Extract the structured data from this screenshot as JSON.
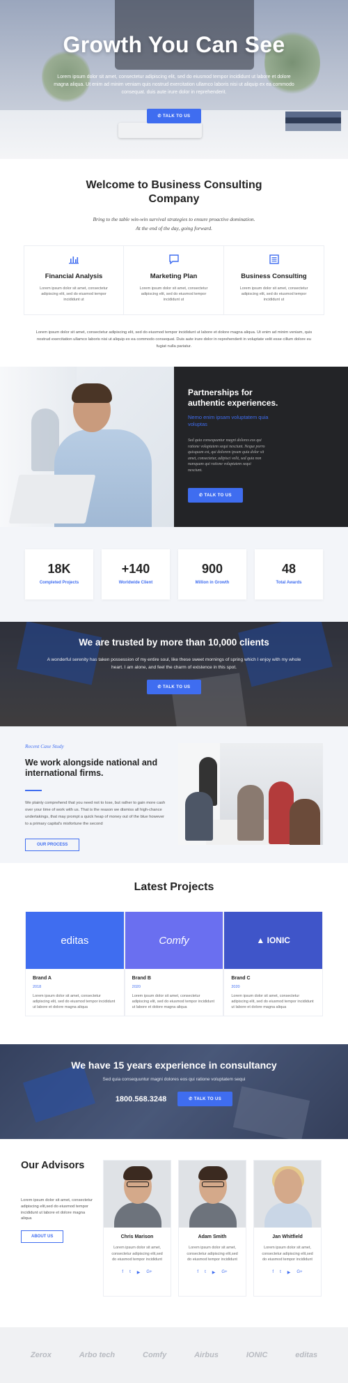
{
  "hero": {
    "title": "Growth You Can See",
    "text": "Lorem ipsum dolor sit amet, consectetur adipiscing elit, sed do eiusmod tempor incididunt ut labore et dolore magna aliqua. Ut enim ad minim veniam quis nostrud exercitation ullamco laboris nisi ut aliquip ex ea commodo consequat. duis aute irure dolor in reprehenderit.",
    "button": "TALK TO US"
  },
  "welcome": {
    "title": "Welcome to Business Consulting Company",
    "subtitle_line1": "Bring to the table win-win survival strategies to ensure proactive domination.",
    "subtitle_line2": "At the end of the day, going forward.",
    "services": [
      {
        "icon": "chart-icon",
        "title": "Financial Analysis",
        "text": "Lorem ipsum dolor sit amet, consectetur adipiscing elit, sed do eiusmod tempor incididunt ut"
      },
      {
        "icon": "chat-icon",
        "title": "Marketing Plan",
        "text": "Lorem ipsum dolor sit amet, consectetur adipiscing elit, sed do eiusmod tempor incididunt ut"
      },
      {
        "icon": "document-icon",
        "title": "Business Consulting",
        "text": "Lorem ipsum dolor sit amet, consectetur adipiscing elit, sed do eiusmod tempor incididunt ut"
      }
    ],
    "paragraph": "Lorem ipsum dolor sit amet, consectetur adipiscing elit, sed do eiusmod tempor incididunt ut labore et dolore magna aliqua. Ut enim ad minim veniam, quis nostrud exercitation ullamco laboris nisi ut aliquip ex ea commodo consequat. Duis aute irure dolor in reprehenderit in voluptate velit esse cillum dolore eu fugiat nulla pariatur."
  },
  "partnership": {
    "title": "Partnerships for authentic experiences.",
    "highlight": "Nemo enim ipsam voluptatem quia voluptas",
    "body": "Sed quia consequuntur magni dolores eos qui ratione voluptatem sequi nesciunt. Neque porro quisquam est, qui dolorem ipsum quia dolor sit amet, consectetur, adipisci velit, sed quia non numquam qui ratione voluptatem sequi nesciunt.",
    "button": "TALK TO US"
  },
  "stats": [
    {
      "value": "18K",
      "label": "Completed Projects"
    },
    {
      "value": "+140",
      "label": "Worldwide Client"
    },
    {
      "value": "900",
      "label": "Million in Growth"
    },
    {
      "value": "48",
      "label": "Total Awards"
    }
  ],
  "trusted": {
    "title": "We are trusted by more than 10,000 clients",
    "text": "A wonderful serenity has taken possession of my entire soul, like these sweet mornings of spring which I enjoy with my whole heart. I am alone, and feel the charm of existence in this spot.",
    "button": "TALK TO US"
  },
  "case_study": {
    "tag": "Recent Case Study",
    "title": "We work alongside national and international firms.",
    "text": "We plainly comprehend that you need not to lose, but rather to gain more cash over your time of work with us. That is the reason we dismiss all high-chance undertakings, that may prompt a quick heap of money out of the blue however to a primary capital's misfortune the second",
    "button": "OUR PROCESS"
  },
  "projects": {
    "title": "Latest Projects",
    "items": [
      {
        "logo": "editas",
        "bg": "#3f6df0",
        "name": "Brand A",
        "year": "2018",
        "text": "Lorem ipsum dolor sit amet, consectetur adipiscing elit, sed do eiusmod tempor incididunt ut labore et dolore magna aliqua"
      },
      {
        "logo": "Comfy",
        "bg": "#6a6ff0",
        "name": "Brand B",
        "year": "2020",
        "text": "Lorem ipsum dolor sit amet, consectetur adipiscing elit, sed do eiusmod tempor incididunt ut labore et dolore magna aliqua"
      },
      {
        "logo": "IONIC",
        "bg": "#3f55c9",
        "name": "Brand C",
        "year": "2020",
        "text": "Lorem ipsum dolor sit amet, consectetur adipiscing elit, sed do eiusmod tempor incididunt ut labore et dolore magna aliqua"
      }
    ]
  },
  "experience": {
    "title": "We have 15 years experience in consultancy",
    "text": "Sed quia consequuntur magni dolores eos qui ratione voluptatem sequi",
    "phone": "1800.568.3248",
    "button": "TALK TO US"
  },
  "advisors": {
    "title": "Our Advisors",
    "text": "Lorem ipsum dolor sit amet, consectetur adipiscing elit,sed do eiusmod tempor incididunt ut labore et dolore magna aliqua",
    "button": "ABOUT US",
    "people": [
      {
        "name": "Chris Marison",
        "text": "Lorem ipsum dolor sit amet, consectetur adipiscing elit,sed do eiusmod tempor incididunt"
      },
      {
        "name": "Adam Smith",
        "text": "Lorem ipsum dolor sit amet, consectetur adipiscing elit,sed do eiusmod tempor incididunt"
      },
      {
        "name": "Jan Whitfield",
        "text": "Lorem ipsum dolor sit amet, consectetur adipiscing elit,sed do eiusmod tempor incididunt"
      }
    ],
    "social": [
      "f",
      "t",
      "▶",
      "G+"
    ]
  },
  "clients": [
    "Zerox",
    "Arbo tech",
    "Comfy",
    "Airbus",
    "IONIC",
    "editas"
  ],
  "colors": {
    "accent": "#3f6df0",
    "dark": "#232427"
  }
}
